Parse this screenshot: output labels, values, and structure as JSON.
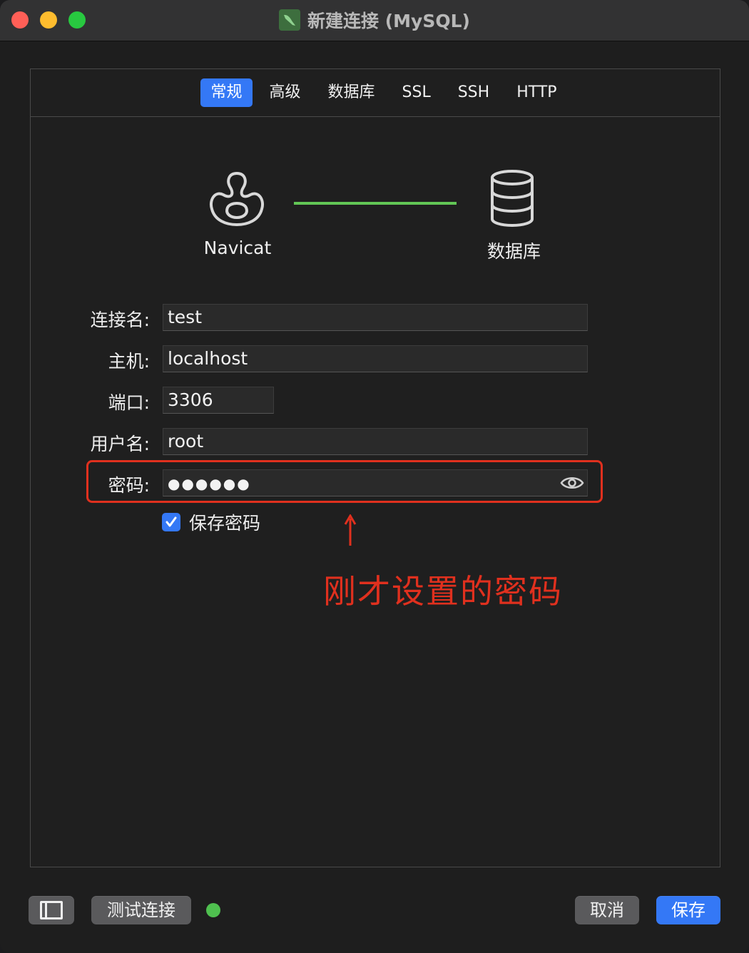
{
  "window": {
    "title": "新建连接 (MySQL)",
    "app_icon": "navicat-mysql-icon"
  },
  "tabs": [
    {
      "label": "常规",
      "active": true
    },
    {
      "label": "高级",
      "active": false
    },
    {
      "label": "数据库",
      "active": false
    },
    {
      "label": "SSL",
      "active": false
    },
    {
      "label": "SSH",
      "active": false
    },
    {
      "label": "HTTP",
      "active": false
    }
  ],
  "diagram": {
    "left_label": "Navicat",
    "right_label": "数据库",
    "left_icon": "navicat-icon",
    "right_icon": "database-icon",
    "line_color": "#62c655"
  },
  "form": {
    "connection_name": {
      "label": "连接名:",
      "value": "test"
    },
    "host": {
      "label": "主机:",
      "value": "localhost"
    },
    "port": {
      "label": "端口:",
      "value": "3306"
    },
    "username": {
      "label": "用户名:",
      "value": "root"
    },
    "password": {
      "label": "密码:",
      "value": "●●●●●●"
    },
    "save_password": {
      "label": "保存密码",
      "checked": true
    }
  },
  "annotation": {
    "text": "刚才设置的密码",
    "color": "#e0301e"
  },
  "footer": {
    "test_button": "测试连接",
    "cancel_button": "取消",
    "save_button": "保存",
    "status_color": "#4fc04f"
  },
  "colors": {
    "accent": "#3478f6",
    "annotation": "#e0301e"
  }
}
